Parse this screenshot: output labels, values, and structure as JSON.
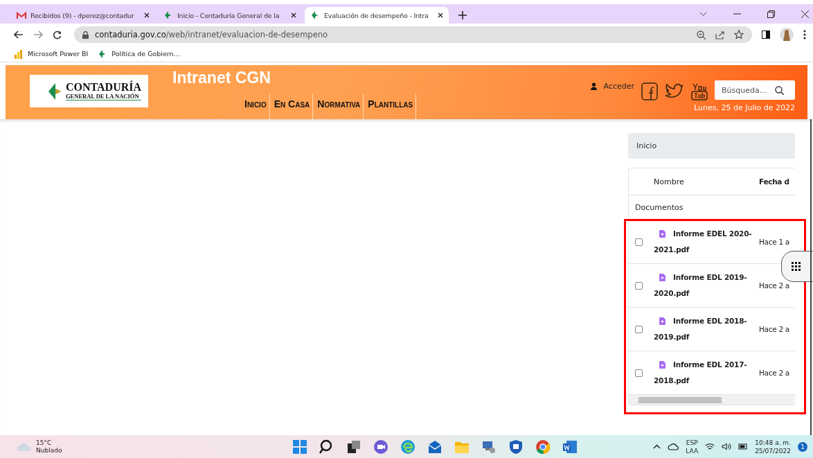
{
  "browser": {
    "tabs": [
      {
        "title": "Recibidos (9) - dperez@contadur",
        "selected": false
      },
      {
        "title": "Inicio - Contaduría General de la",
        "selected": false
      },
      {
        "title": "Evaluación de desempeño - Intra",
        "selected": true
      }
    ],
    "address": {
      "host": "contaduria.gov.co",
      "path": "/web/intranet/evaluacion-de-desempeno"
    },
    "bookmarks": [
      {
        "label": "Microsoft Power BI"
      },
      {
        "label": "Política de Gobiern..."
      }
    ]
  },
  "header": {
    "logo": {
      "line1": "CONTADURÍA",
      "line2": "GENERAL DE LA NACIÓN"
    },
    "title": "Intranet CGN",
    "nav": [
      {
        "label": "Inicio"
      },
      {
        "label": "En Casa"
      },
      {
        "label": "Normativa"
      },
      {
        "label": "Plantillas"
      }
    ],
    "login": "Acceder",
    "search": {
      "placeholder": "Búsqueda..."
    },
    "date": "Lunes, 25 de Julio de 2022"
  },
  "breadcrumb": "Inicio",
  "table": {
    "columns": [
      "Nombre",
      "Fecha d"
    ],
    "section": "Documentos",
    "highlighted": true,
    "rows": [
      {
        "name": "Informe EDEL 2020-2021.pdf",
        "date": "Hace 1 a",
        "checked": false
      },
      {
        "name": "Informe EDL 2019-2020.pdf",
        "date": "Hace 2 a",
        "checked": false
      },
      {
        "name": "Informe EDL 2018-2019.pdf",
        "date": "Hace 2 a",
        "checked": false
      },
      {
        "name": "Informe EDL 2017-2018.pdf",
        "date": "Hace 2 a",
        "checked": false
      }
    ]
  },
  "taskbar": {
    "weather": {
      "temp": "15°C",
      "condition": "Nublado"
    },
    "lang": [
      "ESP",
      "LAA"
    ],
    "time": "10:48 a. m.",
    "date": "25/07/2022",
    "notifications": "1"
  }
}
